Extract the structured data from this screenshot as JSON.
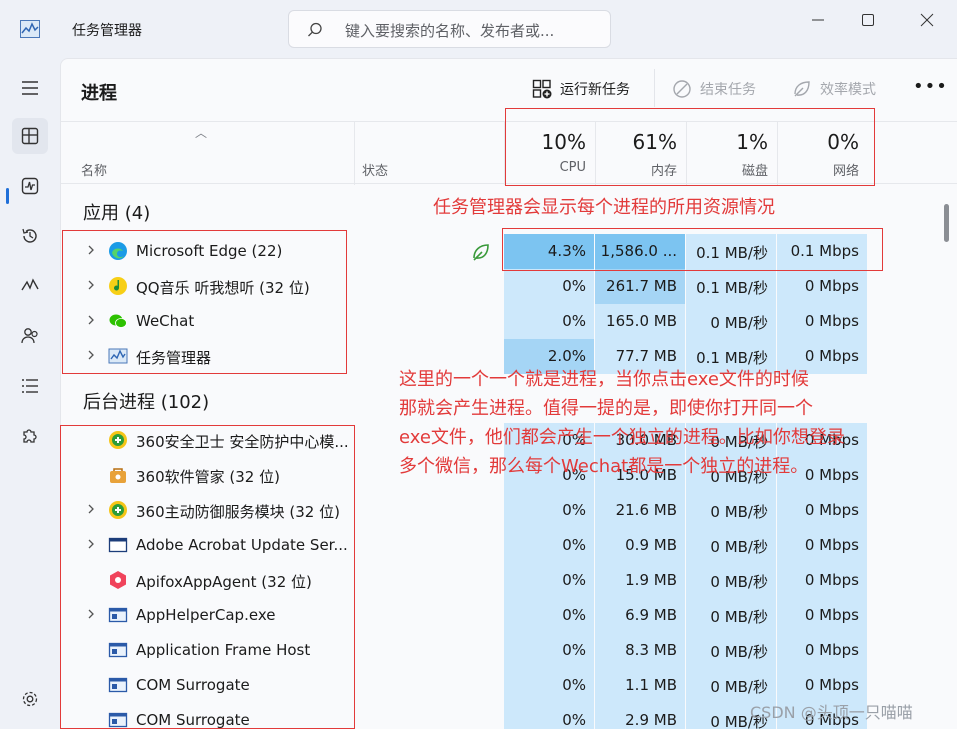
{
  "window": {
    "title": "任务管理器"
  },
  "search": {
    "placeholder": "键入要搜索的名称、发布者或..."
  },
  "toolbar": {
    "page_title": "进程",
    "run_task": "运行新任务",
    "end_task": "结束任务",
    "efficiency": "效率模式",
    "more": "•••"
  },
  "columns": {
    "name": "名称",
    "status": "状态",
    "cpu": {
      "pct": "10%",
      "label": "CPU"
    },
    "mem": {
      "pct": "61%",
      "label": "内存"
    },
    "disk": {
      "pct": "1%",
      "label": "磁盘"
    },
    "net": {
      "pct": "0%",
      "label": "网络"
    }
  },
  "groups": {
    "apps": "应用 (4)",
    "background": "后台进程 (102)"
  },
  "apps": [
    {
      "name": "Microsoft Edge (22)",
      "cpu": "4.3%",
      "mem": "1,586.0 ...",
      "disk": "0.1 MB/秒",
      "net": "0.1 Mbps",
      "icon": "edge-icon"
    },
    {
      "name": "QQ音乐 听我想听 (32 位)",
      "cpu": "0%",
      "mem": "261.7 MB",
      "disk": "0.1 MB/秒",
      "net": "0 Mbps",
      "icon": "qqmusic-icon"
    },
    {
      "name": "WeChat",
      "cpu": "0%",
      "mem": "165.0 MB",
      "disk": "0 MB/秒",
      "net": "0 Mbps",
      "icon": "wechat-icon"
    },
    {
      "name": "任务管理器",
      "cpu": "2.0%",
      "mem": "77.7 MB",
      "disk": "0.1 MB/秒",
      "net": "0 Mbps",
      "icon": "taskmanager-icon"
    }
  ],
  "background": [
    {
      "name": "360安全卫士 安全防护中心模...",
      "cpu": "0%",
      "mem": "30.0 MB",
      "disk": "0 MB/秒",
      "net": "0 Mbps",
      "icon": "360-icon"
    },
    {
      "name": "360软件管家 (32 位)",
      "cpu": "0%",
      "mem": "15.0 MB",
      "disk": "0 MB/秒",
      "net": "0 Mbps",
      "icon": "360-manager-icon"
    },
    {
      "name": "360主动防御服务模块 (32 位)",
      "cpu": "0%",
      "mem": "21.6 MB",
      "disk": "0 MB/秒",
      "net": "0 Mbps",
      "icon": "360-icon"
    },
    {
      "name": "Adobe Acrobat Update Ser...",
      "cpu": "0%",
      "mem": "0.9 MB",
      "disk": "0 MB/秒",
      "net": "0 Mbps",
      "icon": "window-icon"
    },
    {
      "name": "ApifoxAppAgent (32 位)",
      "cpu": "0%",
      "mem": "1.9 MB",
      "disk": "0 MB/秒",
      "net": "0 Mbps",
      "icon": "apifox-icon"
    },
    {
      "name": "AppHelperCap.exe",
      "cpu": "0%",
      "mem": "6.9 MB",
      "disk": "0 MB/秒",
      "net": "0 Mbps",
      "icon": "exe-icon"
    },
    {
      "name": "Application Frame Host",
      "cpu": "0%",
      "mem": "8.3 MB",
      "disk": "0 MB/秒",
      "net": "0 Mbps",
      "icon": "exe-icon"
    },
    {
      "name": "COM Surrogate",
      "cpu": "0%",
      "mem": "1.1 MB",
      "disk": "0 MB/秒",
      "net": "0 Mbps",
      "icon": "exe-icon"
    },
    {
      "name": "COM Surrogate",
      "cpu": "0%",
      "mem": "2.9 MB",
      "disk": "0 MB/秒",
      "net": "0 Mbps",
      "icon": "exe-icon"
    }
  ],
  "annotations": {
    "resource_note": "任务管理器会显示每个进程的所用资源情况",
    "process_note": [
      "这里的一个一个就是进程，当你点击exe文件的时候",
      "那就会产生进程。值得一提的是，即使你打开同一个",
      "exe文件，他们都会产生一个独立的进程。比如你想登录",
      "多个微信，那么每个Wechat都是一个独立的进程。"
    ]
  },
  "watermark": "CSDN @头顶一只喵喵",
  "colors": {
    "heat_light": "#cde8fb",
    "heat_mid": "#a5d5f5",
    "heat_high": "#7cc4f1",
    "annotation": "#e23a3a",
    "accent": "#1f6fd8"
  }
}
